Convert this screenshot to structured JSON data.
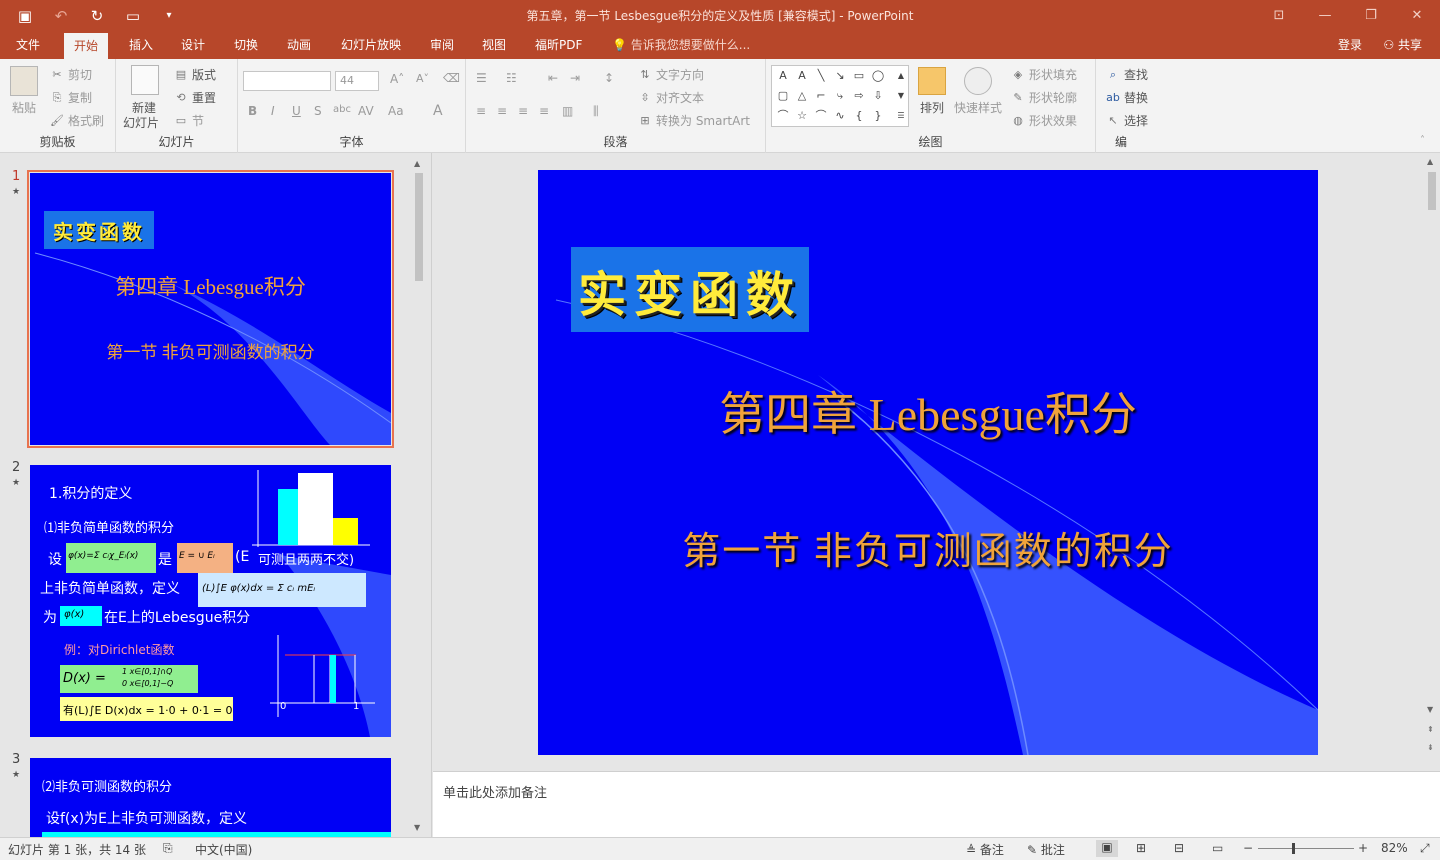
{
  "window": {
    "title": "第五章，第一节  Lesbesgue积分的定义及性质 [兼容模式] - PowerPoint"
  },
  "tabs": [
    {
      "label": "文件",
      "active": false
    },
    {
      "label": "开始",
      "active": true
    },
    {
      "label": "插入",
      "active": false
    },
    {
      "label": "设计",
      "active": false
    },
    {
      "label": "切换",
      "active": false
    },
    {
      "label": "动画",
      "active": false
    },
    {
      "label": "幻灯片放映",
      "active": false
    },
    {
      "label": "审阅",
      "active": false
    },
    {
      "label": "视图",
      "active": false
    },
    {
      "label": "福昕PDF",
      "active": false
    }
  ],
  "tellme": "告诉我您想要做什么...",
  "account": {
    "login": "登录",
    "share": "共享"
  },
  "ribbon": {
    "clipboard": {
      "label": "剪贴板",
      "paste": "粘贴",
      "cut": "剪切",
      "copy": "复制",
      "format_painter": "格式刷"
    },
    "slides": {
      "label": "幻灯片",
      "new_slide_1": "新建",
      "new_slide_2": "幻灯片",
      "layout": "版式",
      "reset": "重置",
      "section": "节"
    },
    "font": {
      "label": "字体",
      "size": "44"
    },
    "paragraph": {
      "label": "段落",
      "text_direction": "文字方向",
      "align_text": "对齐文本",
      "convert_smartart": "转换为 SmartArt"
    },
    "drawing": {
      "label": "绘图",
      "arrange": "排列",
      "quick_styles": "快速样式",
      "shape_fill": "形状填充",
      "shape_outline": "形状轮廓",
      "shape_effects": "形状效果"
    },
    "editing": {
      "label": "编",
      "find": "查找",
      "replace": "替换",
      "select": "选择"
    }
  },
  "slides": [
    {
      "number": "1",
      "title_box": "实变函数",
      "chapter": "第四章  Lebesgue积分",
      "section": "第一节  非负可测函数的积分"
    },
    {
      "number": "2",
      "heading": "1.积分的定义",
      "sub": "⑴非负简单函数的积分",
      "line1a": "设",
      "line1b": "是",
      "line1c": "(E",
      "line1d": "可测且两两不交)",
      "line2": "上非负简单函数，定义",
      "line3a": "为",
      "line3b": "在E上的Lebesgue积分",
      "example": "例：对Dirichlet函数",
      "dx_def": "D(x) =",
      "result": "有(L)∫E D(x)dx = 1·0 + 0·1 = 0",
      "formula_phi": "φ(x)=Σ cᵢχ_Eᵢ(x)",
      "formula_E": "E = ∪ Eᵢ",
      "formula_int": "(L)∫E φ(x)dx = Σ cᵢ mEᵢ",
      "phi_box": "φ(x)",
      "dcase1": "1   x∈[0,1]∩Q",
      "dcase2": "0   x∈[0,1]−Q",
      "axis_zero": "0",
      "axis_one": "1"
    },
    {
      "number": "3",
      "heading": "⑵非负可测函数的积分",
      "line1": "设f(x)为E上非负可测函数，定义"
    }
  ],
  "main_slide": {
    "title_box": "实变函数",
    "chapter": "第四章  Lebesgue积分",
    "section": "第一节  非负可测函数的积分"
  },
  "notes_placeholder": "单击此处添加备注",
  "status": {
    "slide_info": "幻灯片 第 1 张，共 14 张",
    "language": "中文(中国)",
    "notes": "备注",
    "comments": "批注",
    "zoom": "82%"
  },
  "colors": {
    "accent": "#b7472a",
    "slide_bg": "#0000f5",
    "title_gold": "#f0a33a"
  }
}
